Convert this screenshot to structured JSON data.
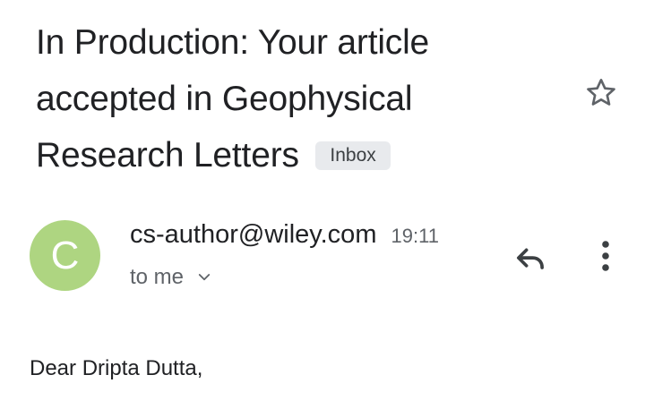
{
  "email": {
    "subject": "In Production: Your article accepted in Geophysical Research Letters",
    "label": "Inbox",
    "sender": {
      "initial": "C",
      "address": "cs-author@wiley.com",
      "time": "19:11",
      "recipient": "to me",
      "avatar_color": "#aed581"
    },
    "body": {
      "greeting": "Dear Dripta Dutta,"
    }
  },
  "icons": {
    "star": "star-outline-icon",
    "reply": "reply-icon",
    "more": "more-vert-icon",
    "chevron": "chevron-down-icon"
  }
}
